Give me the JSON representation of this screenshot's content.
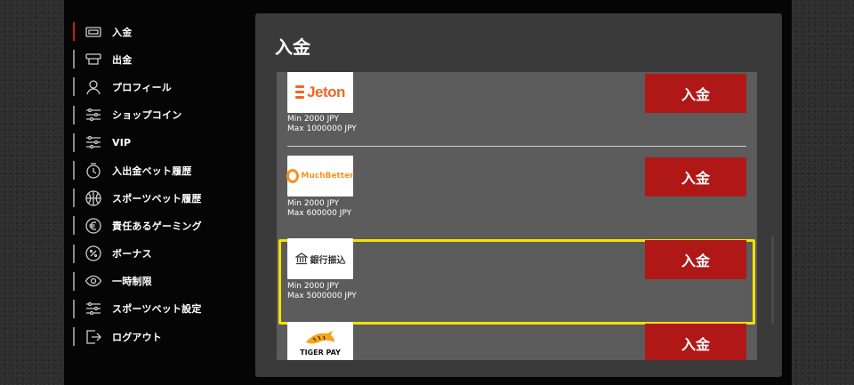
{
  "sidebar": {
    "items": [
      {
        "label": "入金",
        "icon": "deposit-icon",
        "active": true
      },
      {
        "label": "出金",
        "icon": "withdraw-icon",
        "active": false
      },
      {
        "label": "プロフィール",
        "icon": "user-icon",
        "active": false
      },
      {
        "label": "ショップコイン",
        "icon": "sliders-icon",
        "active": false
      },
      {
        "label": "VIP",
        "icon": "sliders-icon",
        "active": false
      },
      {
        "label": "入出金ベット履歴",
        "icon": "history-icon",
        "active": false
      },
      {
        "label": "スポーツベット履歴",
        "icon": "ball-icon",
        "active": false
      },
      {
        "label": "責任あるゲーミング",
        "icon": "euro-icon",
        "active": false
      },
      {
        "label": "ボーナス",
        "icon": "percent-icon",
        "active": false
      },
      {
        "label": "一時制限",
        "icon": "eye-icon",
        "active": false
      },
      {
        "label": "スポーツベット設定",
        "icon": "sliders-icon",
        "active": false
      },
      {
        "label": "ログアウト",
        "icon": "logout-icon",
        "active": false
      }
    ]
  },
  "main": {
    "title": "入金",
    "methods": [
      {
        "logo_text": "Jeton",
        "min": "Min 2000 JPY",
        "max": "Max 1000000 JPY",
        "button": "入金",
        "selected": false
      },
      {
        "logo_text": "MuchBetter",
        "min": "Min 2000 JPY",
        "max": "Max 600000 JPY",
        "button": "入金",
        "selected": false
      },
      {
        "logo_text": "銀行振込",
        "min": "Min 2000 JPY",
        "max": "Max 5000000 JPY",
        "button": "入金",
        "selected": true
      },
      {
        "logo_text": "TIGER PAY",
        "button": "入金",
        "selected": false
      }
    ]
  },
  "colors": {
    "accent": "#b01818",
    "active_indicator": "#c81e1e",
    "highlight": "#f4e200",
    "panel": "#3a3a3a",
    "list": "#5c5c5c"
  }
}
